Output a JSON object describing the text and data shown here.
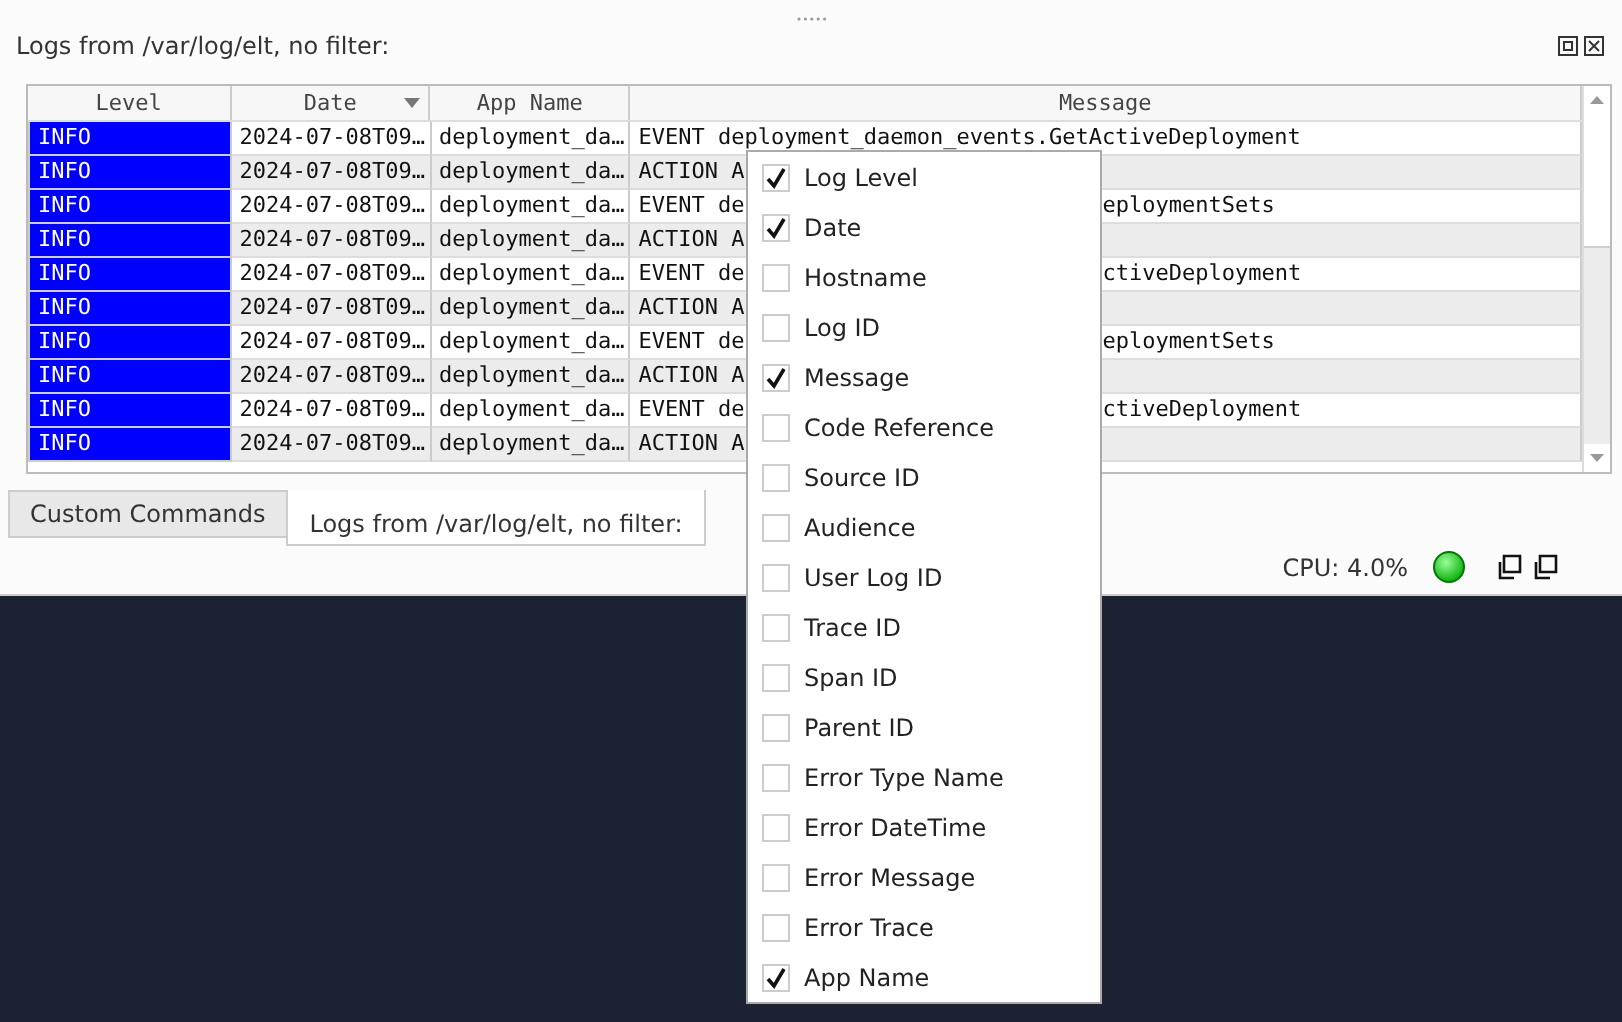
{
  "title": "Logs from /var/log/elt, no filter:",
  "table": {
    "columns": [
      {
        "label": "Level",
        "sorted": false
      },
      {
        "label": "Date",
        "sorted": true
      },
      {
        "label": "App Name",
        "sorted": false
      },
      {
        "label": "Message",
        "sorted": false
      }
    ],
    "rows": [
      {
        "level": "INFO",
        "date": "2024-07-08T09…",
        "app": "deployment_da…",
        "message": "EVENT deployment_daemon_events.GetActiveDeployment"
      },
      {
        "level": "INFO",
        "date": "2024-07-08T09…",
        "app": "deployment_da…",
        "message": "ACTION A"
      },
      {
        "level": "INFO",
        "date": "2024-07-08T09…",
        "app": "deployment_da…",
        "message": "EVENT de",
        "message_end": "eploymentSets"
      },
      {
        "level": "INFO",
        "date": "2024-07-08T09…",
        "app": "deployment_da…",
        "message": "ACTION A"
      },
      {
        "level": "INFO",
        "date": "2024-07-08T09…",
        "app": "deployment_da…",
        "message": "EVENT de",
        "message_end": "ctiveDeployment"
      },
      {
        "level": "INFO",
        "date": "2024-07-08T09…",
        "app": "deployment_da…",
        "message": "ACTION A"
      },
      {
        "level": "INFO",
        "date": "2024-07-08T09…",
        "app": "deployment_da…",
        "message": "EVENT de",
        "message_end": "eploymentSets"
      },
      {
        "level": "INFO",
        "date": "2024-07-08T09…",
        "app": "deployment_da…",
        "message": "ACTION A"
      },
      {
        "level": "INFO",
        "date": "2024-07-08T09…",
        "app": "deployment_da…",
        "message": "EVENT de",
        "message_end": "ctiveDeployment"
      },
      {
        "level": "INFO",
        "date": "2024-07-08T09…",
        "app": "deployment_da…",
        "message": "ACTION A"
      }
    ]
  },
  "tabs": [
    {
      "label": "Custom Commands",
      "selected": false
    },
    {
      "label": "Logs from /var/log/elt, no filter:",
      "selected": true
    }
  ],
  "status": {
    "cpu": "CPU: 4.0%"
  },
  "column_menu": [
    {
      "label": "Log Level",
      "checked": true
    },
    {
      "label": "Date",
      "checked": true
    },
    {
      "label": "Hostname",
      "checked": false
    },
    {
      "label": "Log ID",
      "checked": false
    },
    {
      "label": "Message",
      "checked": true
    },
    {
      "label": "Code Reference",
      "checked": false
    },
    {
      "label": "Source ID",
      "checked": false
    },
    {
      "label": "Audience",
      "checked": false
    },
    {
      "label": "User Log ID",
      "checked": false
    },
    {
      "label": "Trace ID",
      "checked": false
    },
    {
      "label": "Span ID",
      "checked": false
    },
    {
      "label": "Parent ID",
      "checked": false
    },
    {
      "label": "Error Type Name",
      "checked": false
    },
    {
      "label": "Error DateTime",
      "checked": false
    },
    {
      "label": "Error Message",
      "checked": false
    },
    {
      "label": "Error Trace",
      "checked": false
    },
    {
      "label": "App Name",
      "checked": true
    }
  ]
}
